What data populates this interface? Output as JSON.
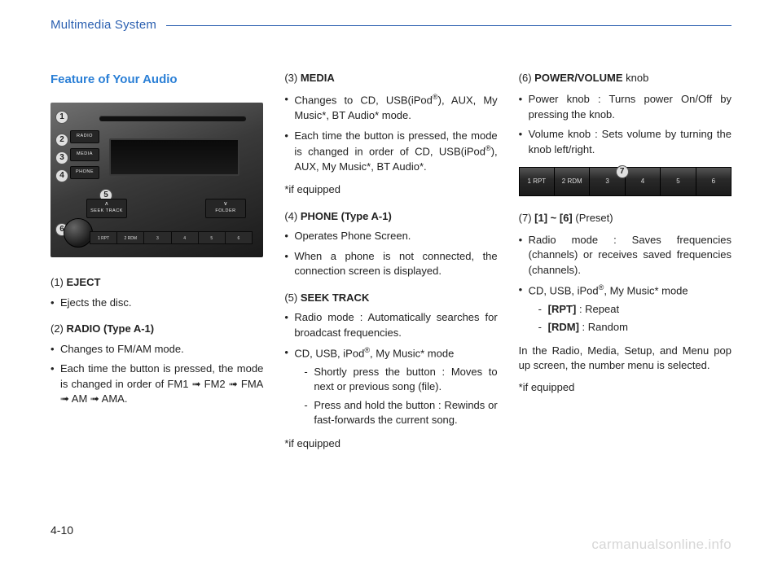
{
  "header": {
    "title": "Multimedia System"
  },
  "page_number": "4-10",
  "watermark": "carmanualsonline.info",
  "col1": {
    "section_title": "Feature of Your Audio",
    "img": {
      "circles": [
        "1",
        "2",
        "3",
        "4",
        "5",
        "6"
      ]
    },
    "radio_label": "RADIO",
    "media_label": "MEDIA",
    "phone_label": "PHONE",
    "seek_label": "SEEK TRACK",
    "folder_label": "FOLDER",
    "presets": [
      "1 RPT",
      "2 RDM",
      "3",
      "4",
      "5",
      "6"
    ],
    "item1_head_num": "(1) ",
    "item1_head_bold": "EJECT",
    "item1_b1": "Ejects the disc.",
    "item2_head_num": "(2) ",
    "item2_head_bold": "RADIO (Type A-1)",
    "item2_b1": "Changes to FM/AM mode.",
    "item2_b2": "Each time the button is pressed, the mode is changed in order of FM1 ➟ FM2 ➟ FMA ➟ AM ➟ AMA."
  },
  "col2": {
    "item3_head_num": "(3) ",
    "item3_head_bold": "MEDIA",
    "item3_b1_pre": "Changes to CD, USB(iPod",
    "item3_b1_post": "), AUX, My Music*, BT Audio* mode.",
    "item3_b2_pre": "Each time the button is pressed, the mode is changed in order of CD, USB(iPod",
    "item3_b2_post": "), AUX, My Music*, BT Audio*.",
    "item3_note": "*if equipped",
    "item4_head_num": "(4) ",
    "item4_head_bold": "PHONE (Type A-1)",
    "item4_b1": "Operates Phone Screen.",
    "item4_b2": "When a phone is not connected, the connection screen is displayed.",
    "item5_head_num": "(5) ",
    "item5_head_bold": "SEEK TRACK",
    "item5_b1": "Radio mode : Automatically searches for broadcast frequencies.",
    "item5_b2_pre": "CD, USB, iPod",
    "item5_b2_post": ", My Music* mode",
    "item5_d1": "Shortly press the button : Moves to next or previous song (file).",
    "item5_d2": "Press and hold the button : Rewinds or fast-forwards the current song.",
    "item5_note": "*if equipped"
  },
  "col3": {
    "item6_head_num": "(6) ",
    "item6_head_bold": "POWER/VOLUME",
    "item6_head_tail": " knob",
    "item6_b1": "Power knob : Turns power On/Off by pressing the knob.",
    "item6_b2": "Volume knob : Sets volume by turning the knob left/right.",
    "preset_img": {
      "circle": "7",
      "slots": [
        "1 RPT",
        "2 RDM",
        "3",
        "4",
        "5",
        "6"
      ]
    },
    "item7_head_num": "(7) ",
    "item7_head_bold": "[1] ~ [6]",
    "item7_head_tail": " (Preset)",
    "item7_b1": "Radio mode : Saves frequencies (channels) or receives saved frequencies (channels).",
    "item7_b2_pre": "CD, USB, iPod",
    "item7_b2_post": ", My Music* mode",
    "item7_d1_bold": "[RPT]",
    "item7_d1_tail": " : Repeat",
    "item7_d2_bold": "[RDM]",
    "item7_d2_tail": " : Random",
    "tail_p": "In the Radio, Media, Setup, and Menu pop up screen, the number menu is selected.",
    "tail_note": "*if equipped"
  },
  "reg_mark": "®"
}
